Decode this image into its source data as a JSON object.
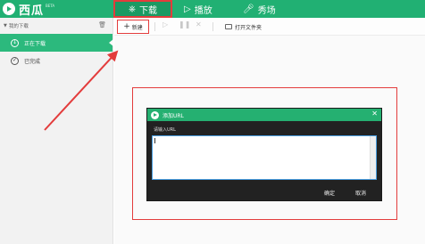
{
  "app": {
    "name": "西瓜",
    "badge": "BETA"
  },
  "header": {
    "tabs": [
      {
        "label": "下载",
        "icon": "cloud-download-icon",
        "active": true
      },
      {
        "label": "播放",
        "icon": "play-screen-icon",
        "active": false
      },
      {
        "label": "秀场",
        "icon": "microphone-icon",
        "active": false
      }
    ]
  },
  "sidebar": {
    "header": "我的下载",
    "items": [
      {
        "label": "正在下载",
        "icon": "download-circle-icon",
        "active": true
      },
      {
        "label": "已完成",
        "icon": "check-circle-icon",
        "active": false
      }
    ]
  },
  "toolbar": {
    "new_label": "新建",
    "open_folder_label": "打开文件夹"
  },
  "dialog": {
    "title": "添加URL",
    "prompt": "请输入URL",
    "input_value": "",
    "ok_label": "确定",
    "cancel_label": "取消"
  },
  "colors": {
    "brand_green": "#21b073",
    "highlight_red": "#e33c3c"
  }
}
